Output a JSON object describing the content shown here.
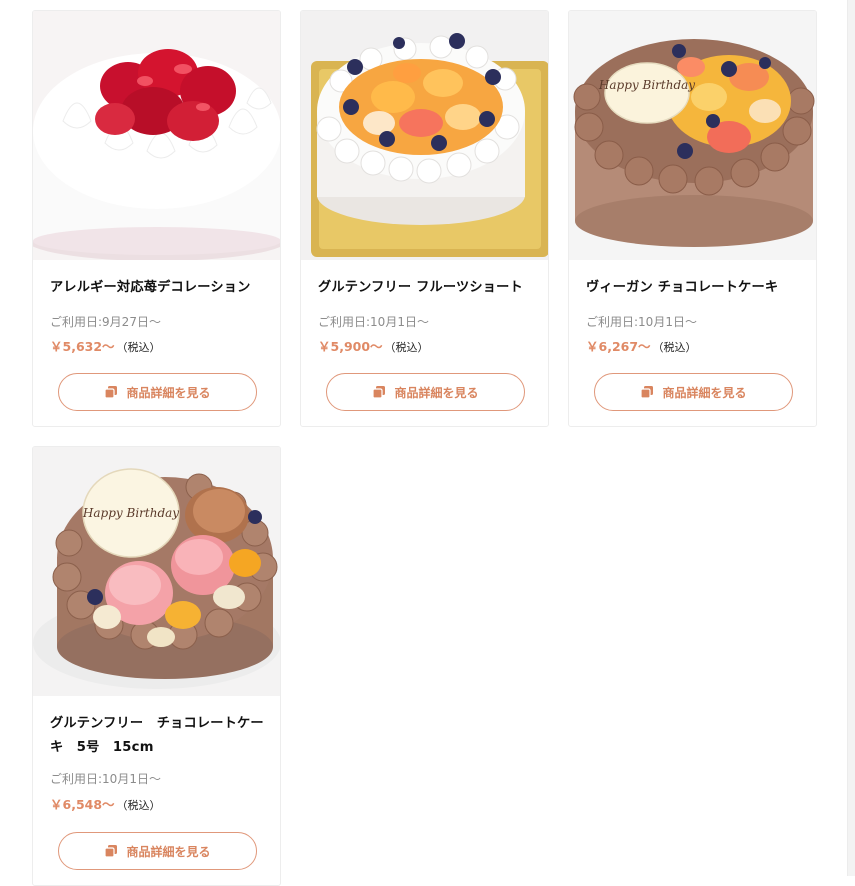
{
  "products": [
    {
      "name": "アレルギー対応苺デコレーション",
      "date": "ご利用日:9月27日～",
      "price": "￥5,632～",
      "tax": "（税込）",
      "button": "商品詳細を見る"
    },
    {
      "name": "グルテンフリー フルーツショート",
      "date": "ご利用日:10月1日～",
      "price": "￥5,900～",
      "tax": "（税込）",
      "button": "商品詳細を見る"
    },
    {
      "name": "ヴィーガン チョコレートケーキ",
      "date": "ご利用日:10月1日～",
      "price": "￥6,267～",
      "tax": "（税込）",
      "button": "商品詳細を見る"
    },
    {
      "name": "グルテンフリー　チョコレートケーキ　5号　15cm",
      "date": "ご利用日:10月1日～",
      "price": "￥6,548～",
      "tax": "（税込）",
      "button": "商品詳細を見る"
    }
  ],
  "colors": {
    "accent": "#e0987b",
    "price": "#e08a66",
    "muted_text": "#8c8c8c",
    "card_border": "#ededed"
  },
  "icons": {
    "detail_button": "copy-icon"
  },
  "plaque_text": {
    "card3": "Happy Birthday",
    "card4": "Happy Birthday"
  }
}
